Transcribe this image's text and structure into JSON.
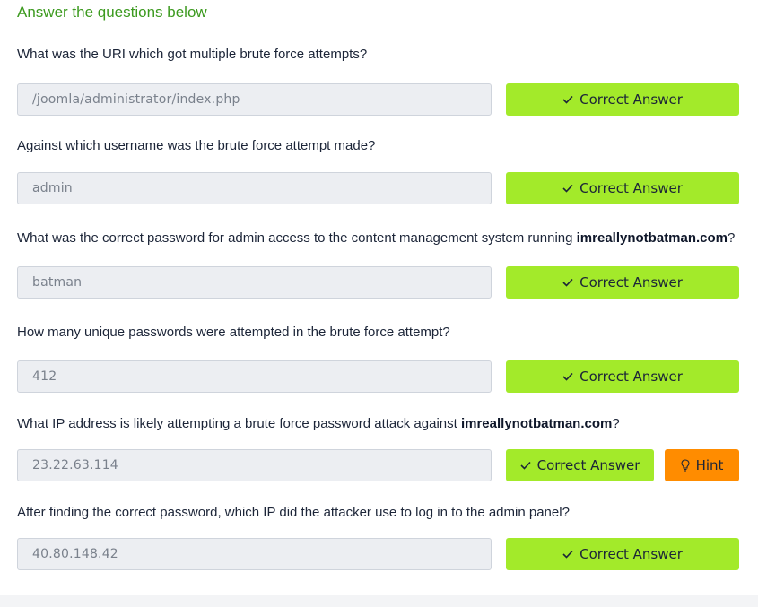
{
  "section": {
    "title": "Answer the questions below"
  },
  "questions": [
    {
      "text": "What was the URI which got multiple brute force attempts?",
      "answer": "/joomla/administrator/index.php",
      "button": "Correct Answer"
    },
    {
      "text": "Against which username was the brute force attempt made?",
      "answer": "admin",
      "button": "Correct Answer"
    },
    {
      "text_pre": "What was the correct password for admin access to the content management system running ",
      "text_bold": "imreallynotbatman.com",
      "text_post": "?",
      "answer": "batman",
      "button": "Correct Answer"
    },
    {
      "text": "How many unique passwords were attempted in the brute force attempt?",
      "answer": "412",
      "button": "Correct Answer"
    },
    {
      "text_pre": "What IP address is likely attempting a brute force password attack against ",
      "text_bold": "imreallynotbatman.com",
      "text_post": "?",
      "answer": "23.22.63.114",
      "button": "Correct Answer",
      "hint": "Hint"
    },
    {
      "text": "After finding the correct password, which IP did the attacker use to log in to the admin panel?",
      "answer": "40.80.148.42",
      "button": "Correct Answer"
    }
  ],
  "colors": {
    "accent_title": "#3c9a1f",
    "correct_button": "#a3ea2a",
    "hint_button": "#ff8c00",
    "input_bg": "#eceef2"
  },
  "icons": {
    "correct": "check-icon",
    "hint": "lightbulb-icon"
  }
}
